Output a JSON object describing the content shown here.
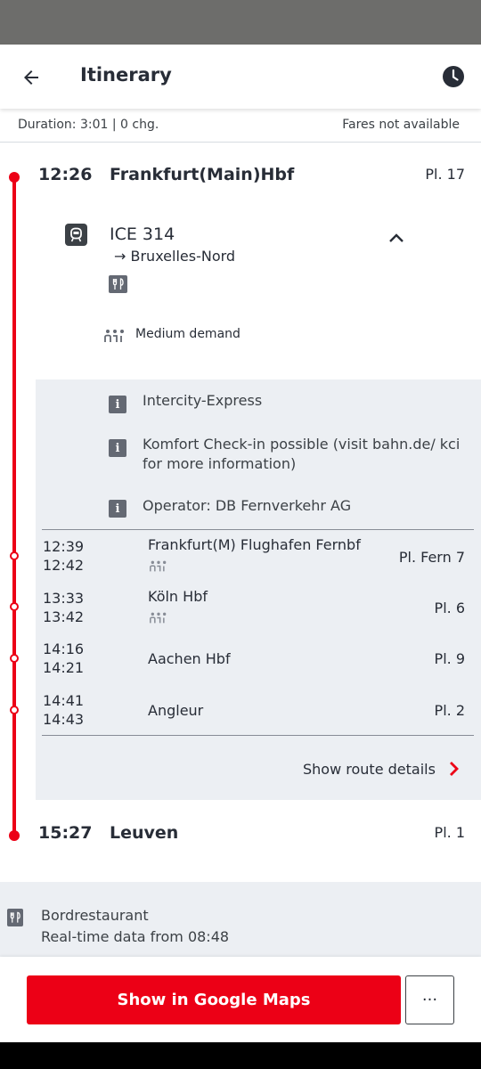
{
  "appbar": {
    "title": "Itinerary"
  },
  "summary": {
    "duration": "Duration: 3:01 | 0 chg.",
    "fares": "Fares not available"
  },
  "origin": {
    "time": "12:26",
    "station": "Frankfurt(Main)Hbf",
    "platform": "Pl. 17"
  },
  "train": {
    "name": "ICE 314",
    "direction": "Bruxelles-Nord",
    "demand": "Medium demand"
  },
  "info": [
    {
      "text": "Intercity-Express"
    },
    {
      "text": "Komfort Check-in possible (visit bahn.de/ kci for more information)"
    },
    {
      "text": "Operator: DB Fernverkehr AG"
    }
  ],
  "intermediate_stops": [
    {
      "arr": "12:39",
      "dep": "12:42",
      "station": "Frankfurt(M) Flughafen Fernbf",
      "platform": "Pl. Fern 7"
    },
    {
      "arr": "13:33",
      "dep": "13:42",
      "station": "Köln Hbf",
      "platform": "Pl. 6"
    },
    {
      "arr": "14:16",
      "dep": "14:21",
      "station": "Aachen Hbf",
      "platform": "Pl. 9"
    },
    {
      "arr": "14:41",
      "dep": "14:43",
      "station": "Angleur",
      "platform": "Pl. 2"
    }
  ],
  "route_link": "Show route details",
  "destination": {
    "time": "15:27",
    "station": "Leuven",
    "platform": "Pl. 1"
  },
  "footer": {
    "line1": "Bordrestaurant",
    "line2": "Real-time data from 08:48"
  },
  "actions": {
    "maps_label": "Show in Google Maps",
    "more_label": "···"
  },
  "colors": {
    "accent": "#ec0016",
    "panel": "#eceff3",
    "text": "#282d37"
  }
}
